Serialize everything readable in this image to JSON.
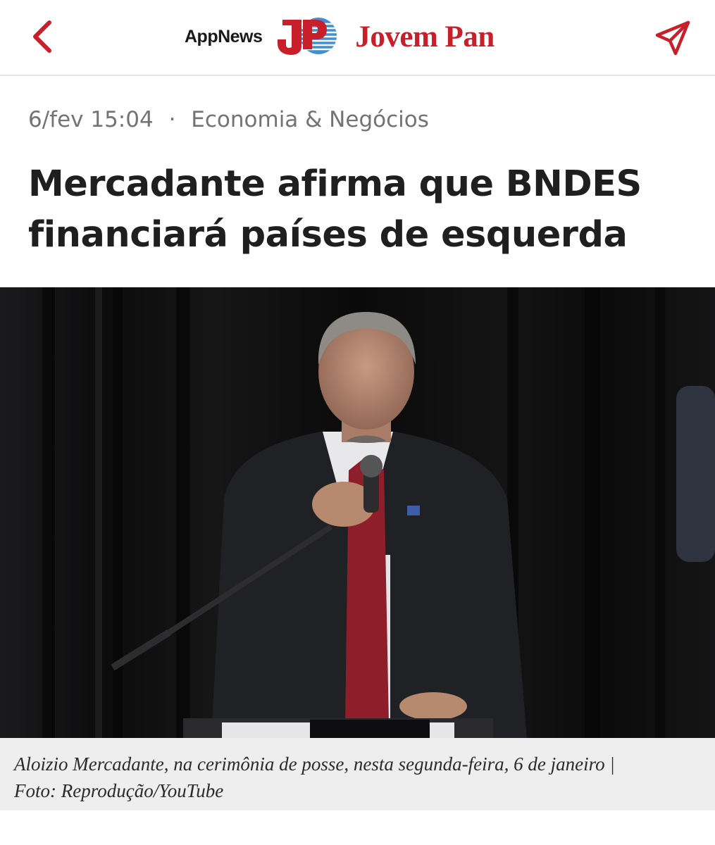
{
  "header": {
    "app_label": "AppNews",
    "brand_name": "Jovem Pan",
    "brand_color": "#c8202b",
    "back_icon": "chevron-left-icon",
    "share_icon": "paper-plane-icon"
  },
  "article": {
    "date": "6/fev 15:04",
    "separator": "·",
    "category": "Economia & Negócios",
    "title_line1": "Mercadante afirma que BNDES",
    "title_line2": "financiará países de esquerda",
    "photo_caption_line1": "Aloizio Mercadante, na cerimônia de posse, nesta segunda-feira, 6 de janeiro |",
    "photo_caption_line2": "Foto: Reprodução/YouTube"
  }
}
